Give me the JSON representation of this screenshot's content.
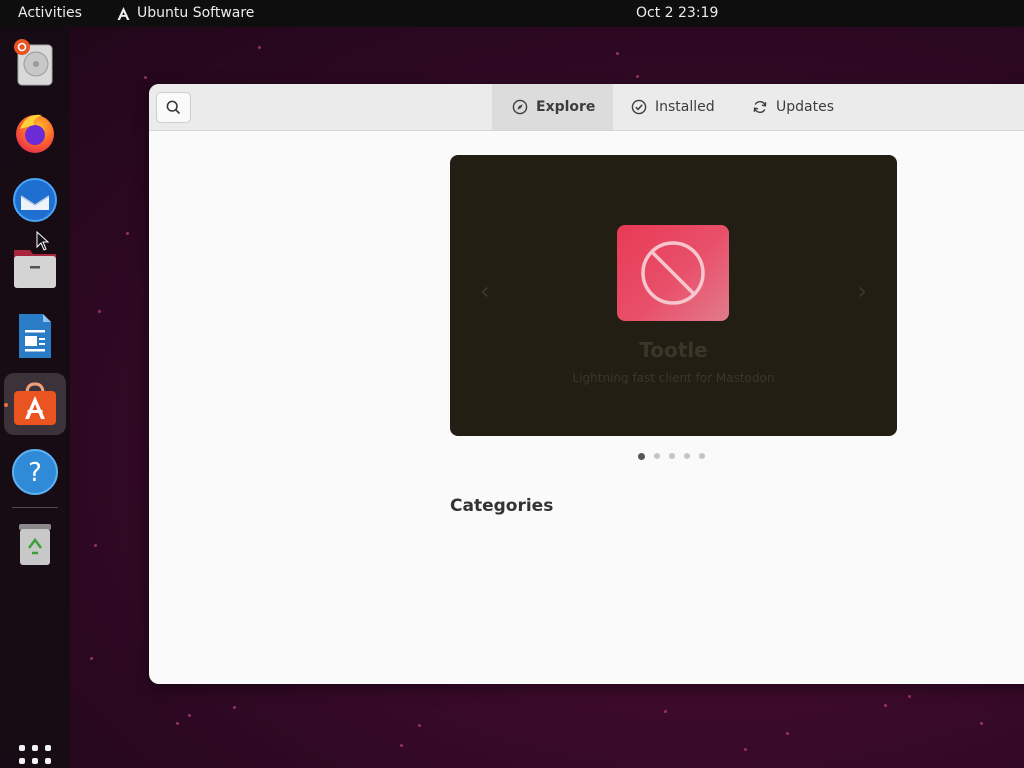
{
  "topbar": {
    "activities": "Activities",
    "app_menu": "Ubuntu Software",
    "clock": "Oct 2  23:19"
  },
  "dock": {
    "items": [
      {
        "icon": "disk-installer-icon",
        "active": false
      },
      {
        "icon": "firefox-icon",
        "active": false
      },
      {
        "icon": "thunderbird-icon",
        "active": false
      },
      {
        "icon": "files-icon",
        "active": false
      },
      {
        "icon": "libreoffice-writer-icon",
        "active": false
      },
      {
        "icon": "ubuntu-software-icon",
        "active": true
      },
      {
        "icon": "help-icon",
        "active": false
      },
      {
        "icon": "trash-icon",
        "active": false
      }
    ],
    "show_apps_icon": "app-grid-icon"
  },
  "window": {
    "search_icon": "search-icon",
    "tabs": [
      {
        "label": "Explore",
        "icon": "compass-icon",
        "active": true
      },
      {
        "label": "Installed",
        "icon": "check-circle-icon",
        "active": false
      },
      {
        "label": "Updates",
        "icon": "refresh-icon",
        "active": false
      }
    ],
    "featured": {
      "app_name": "Tootle",
      "summary": "Lightning fast client for Mastodon",
      "prev_arrow": "‹",
      "next_arrow": "›",
      "page_count": 5,
      "active_page": 1
    },
    "categories_title": "Categories"
  },
  "colors": {
    "ubuntu_orange": "#e95420",
    "carousel_bg": "#231e13",
    "app_icon": "#e83a55"
  }
}
